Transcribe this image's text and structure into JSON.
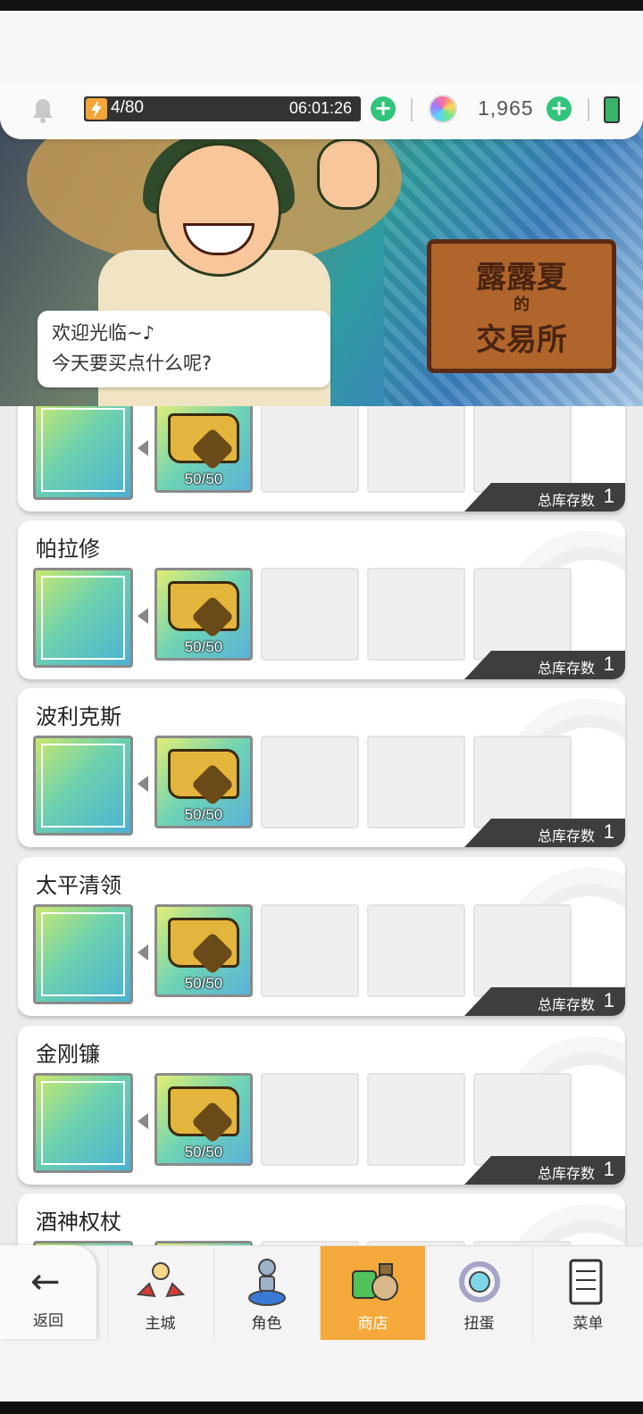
{
  "status_bar": {
    "energy": "4/80",
    "timer": "06:01:26",
    "gems": "1,965"
  },
  "banner": {
    "sign_line1": "露露夏",
    "sign_line2": "的",
    "sign_line3": "交易所",
    "speech_line1": "欢迎光临~♪",
    "speech_line2": "今天要买点什么呢?"
  },
  "items": [
    {
      "name": "",
      "material_count": "50/50",
      "stock_label": "总库存数",
      "stock": "1"
    },
    {
      "name": "帕拉修",
      "material_count": "50/50",
      "stock_label": "总库存数",
      "stock": "1"
    },
    {
      "name": "波利克斯",
      "material_count": "50/50",
      "stock_label": "总库存数",
      "stock": "1"
    },
    {
      "name": "太平清领",
      "material_count": "50/50",
      "stock_label": "总库存数",
      "stock": "1"
    },
    {
      "name": "金刚镰",
      "material_count": "50/50",
      "stock_label": "总库存数",
      "stock": "1"
    },
    {
      "name": "酒神权杖",
      "material_count": "",
      "stock_label": "",
      "stock": ""
    }
  ],
  "nav": {
    "back": "返回",
    "main_city": "主城",
    "character": "角色",
    "shop": "商店",
    "gacha": "扭蛋",
    "menu": "菜单"
  },
  "colors": {
    "active_tab": "#f5a93a",
    "plus_button": "#31c47d",
    "stock_bar": "#3e3e3e"
  }
}
